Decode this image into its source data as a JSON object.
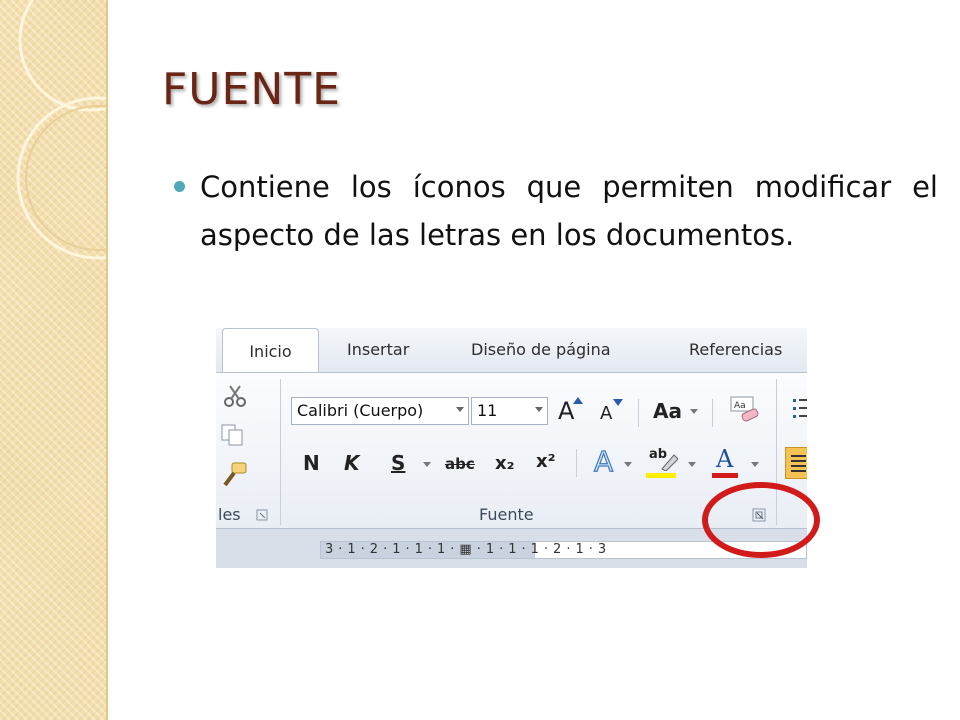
{
  "slide": {
    "title": "FUENTE",
    "bullet": "Contiene los íconos que permiten modificar el aspecto de las letras en los documentos."
  },
  "ribbon": {
    "tabs": [
      "Inicio",
      "Insertar",
      "Diseño de página",
      "Referencias"
    ],
    "active_tab": "Inicio",
    "font_name": "Calibri (Cuerpo)",
    "font_size": "11",
    "partial_group_label": "les",
    "group_label": "Fuente",
    "ruler_marks": "3·1·2·1·1·1·▦·1·1·1·2·1·3",
    "buttons": {
      "grow": "A",
      "shrink": "A",
      "case": "Aa",
      "bold": "N",
      "italic": "K",
      "underline": "S",
      "strike": "abc",
      "sub": "x₂",
      "sup": "x²",
      "highlight": "ab",
      "font_color": "A",
      "clear": "Aa"
    }
  },
  "colors": {
    "title": "#6b2515",
    "bullet": "#4eaab8",
    "highlight": "#ffee00",
    "font_color_bar": "#d11a1a",
    "circle": "#d11a1a"
  }
}
